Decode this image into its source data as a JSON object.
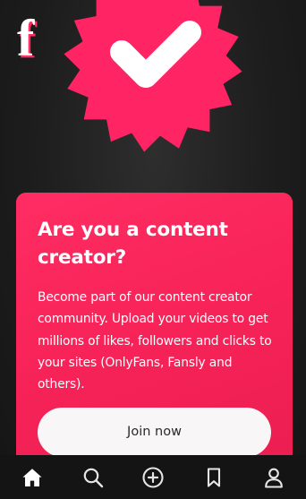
{
  "brand": {
    "logo_letter": "f",
    "logo_color": "#ffffff",
    "logo_shadow_color": "#ff2d63"
  },
  "badge": {
    "icon": "checkmark-badge-icon",
    "color": "#ff2463",
    "check_color": "#ffffff"
  },
  "promo": {
    "title": "Are you a content creator?",
    "description": "Become part of our content creator community. Upload your videos to get millions of likes, followers and clicks to your sites (OnlyFans, Fansly and others).",
    "button_label": "Join now",
    "accent_color": "#f72359"
  },
  "bottom_nav": {
    "active": "home",
    "items": [
      {
        "id": "home",
        "icon": "home-icon"
      },
      {
        "id": "search",
        "icon": "search-icon"
      },
      {
        "id": "add",
        "icon": "plus-circle-icon"
      },
      {
        "id": "saved",
        "icon": "bookmark-icon"
      },
      {
        "id": "profile",
        "icon": "user-icon"
      }
    ]
  }
}
